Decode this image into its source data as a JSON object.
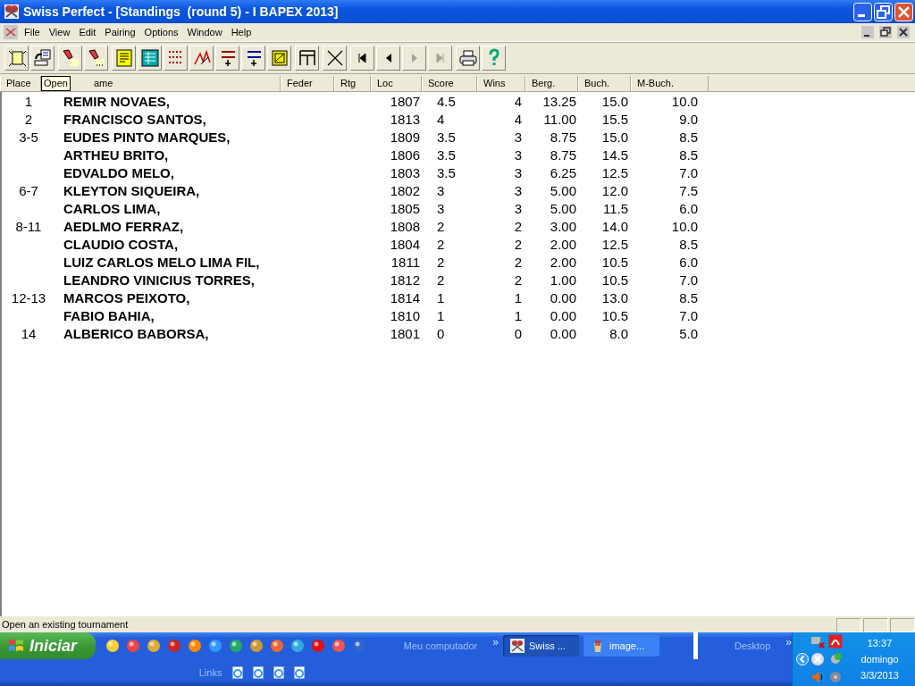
{
  "window": {
    "title": "Swiss Perfect - [Standings  (round 5) - I BAPEX 2013]"
  },
  "menu": [
    "File",
    "View",
    "Edit",
    "Pairing",
    "Options",
    "Window",
    "Help"
  ],
  "toolbar": [
    [
      {
        "kind": "new",
        "disabled": false
      },
      {
        "kind": "open",
        "disabled": false
      }
    ],
    [
      {
        "kind": "find",
        "disabled": false
      },
      {
        "kind": "find-more",
        "disabled": false
      }
    ],
    [
      {
        "kind": "list",
        "disabled": false
      },
      {
        "kind": "grid",
        "disabled": false
      },
      {
        "kind": "crosstable",
        "disabled": false
      },
      {
        "kind": "pairs",
        "disabled": false
      },
      {
        "kind": "rating-plus",
        "disabled": false
      },
      {
        "kind": "number-plus",
        "disabled": false
      },
      {
        "kind": "export",
        "disabled": false
      }
    ],
    [
      {
        "kind": "table",
        "disabled": false
      }
    ],
    [
      {
        "kind": "swords",
        "disabled": false
      }
    ],
    [
      {
        "kind": "first",
        "disabled": false
      },
      {
        "kind": "prev",
        "disabled": false
      },
      {
        "kind": "next",
        "disabled": true
      },
      {
        "kind": "last",
        "disabled": true
      }
    ],
    [
      {
        "kind": "print",
        "disabled": false
      },
      {
        "kind": "help",
        "disabled": false
      }
    ]
  ],
  "tooltip": "Open",
  "table": {
    "columns": [
      "Place",
      "ame",
      "Feder",
      "Rtg",
      "Loc",
      "Score",
      "Wins",
      "Berg.",
      "Buch.",
      "M-Buch."
    ],
    "rows": [
      [
        "1",
        "REMIR NOVAES,",
        "",
        "",
        "1807",
        "4.5",
        "4",
        "13.25",
        "15.0",
        "10.0"
      ],
      [
        "2",
        "FRANCISCO SANTOS,",
        "",
        "",
        "1813",
        "4",
        "4",
        "11.00",
        "15.5",
        "9.0"
      ],
      [
        "3-5",
        "EUDES PINTO MARQUES,",
        "",
        "",
        "1809",
        "3.5",
        "3",
        "8.75",
        "15.0",
        "8.5"
      ],
      [
        "",
        "ARTHEU BRITO,",
        "",
        "",
        "1806",
        "3.5",
        "3",
        "8.75",
        "14.5",
        "8.5"
      ],
      [
        "",
        "EDVALDO MELO,",
        "",
        "",
        "1803",
        "3.5",
        "3",
        "6.25",
        "12.5",
        "7.0"
      ],
      [
        "6-7",
        "KLEYTON SIQUEIRA,",
        "",
        "",
        "1802",
        "3",
        "3",
        "5.00",
        "12.0",
        "7.5"
      ],
      [
        "",
        "CARLOS LIMA,",
        "",
        "",
        "1805",
        "3",
        "3",
        "5.00",
        "11.5",
        "6.0"
      ],
      [
        "8-11",
        "AEDLMO FERRAZ,",
        "",
        "",
        "1808",
        "2",
        "2",
        "3.00",
        "14.0",
        "10.0"
      ],
      [
        "",
        "CLAUDIO COSTA,",
        "",
        "",
        "1804",
        "2",
        "2",
        "2.00",
        "12.5",
        "8.5"
      ],
      [
        "",
        "LUIZ CARLOS MELO LIMA FIL,",
        "",
        "",
        "1811",
        "2",
        "2",
        "2.00",
        "10.5",
        "6.0"
      ],
      [
        "",
        "LEANDRO VINICIUS TORRES,",
        "",
        "",
        "1812",
        "2",
        "2",
        "1.00",
        "10.5",
        "7.0"
      ],
      [
        "12-13",
        "MARCOS PEIXOTO,",
        "",
        "",
        "1814",
        "1",
        "1",
        "0.00",
        "13.0",
        "8.5"
      ],
      [
        "",
        "FABIO BAHIA,",
        "",
        "",
        "1810",
        "1",
        "1",
        "0.00",
        "10.5",
        "7.0"
      ],
      [
        "14",
        "ALBERICO BABORSA,",
        "",
        "",
        "1801",
        "0",
        "0",
        "0.00",
        "8.0",
        "5.0"
      ]
    ]
  },
  "status_bar": "Open an existing tournament",
  "taskbar": {
    "start": "Iniciar",
    "links_label": "Links",
    "address_label": "Meu computador",
    "more": "»",
    "tasks": [
      {
        "label": "Swiss ...",
        "selected": true
      },
      {
        "label": "image...",
        "selected": false
      }
    ],
    "desktop_label": "Desktop",
    "desktop_more": "»",
    "clock": {
      "time": "13:37",
      "day": "domingo",
      "date": "3/3/2013"
    }
  }
}
